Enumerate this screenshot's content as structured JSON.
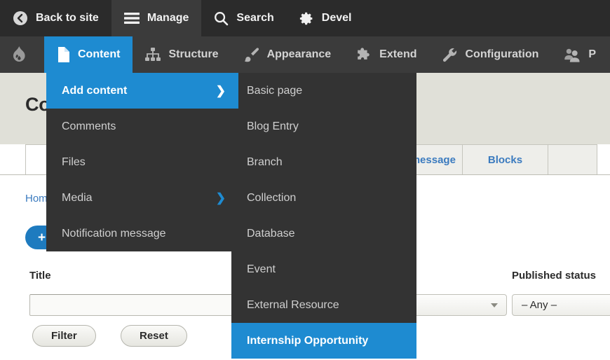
{
  "toolbar": {
    "top": [
      {
        "label": "Back to site",
        "icon": "back-arrow-icon",
        "active": false
      },
      {
        "label": "Manage",
        "icon": "hamburger-icon",
        "active": true
      },
      {
        "label": "Search",
        "icon": "search-icon",
        "active": false
      },
      {
        "label": "Devel",
        "icon": "gear-icon",
        "active": false
      }
    ],
    "second": [
      {
        "label": "",
        "icon": "drupal-logo-icon",
        "active": false
      },
      {
        "label": "Content",
        "icon": "document-icon",
        "active": true
      },
      {
        "label": "Structure",
        "icon": "sitemap-icon",
        "active": false
      },
      {
        "label": "Appearance",
        "icon": "paintbrush-icon",
        "active": false
      },
      {
        "label": "Extend",
        "icon": "puzzle-icon",
        "active": false
      },
      {
        "label": "Configuration",
        "icon": "wrench-icon",
        "active": false
      },
      {
        "label": "P",
        "icon": "people-icon",
        "active": false
      }
    ]
  },
  "menu": {
    "level1": [
      {
        "label": "Add content",
        "selected": true,
        "has_submenu": true,
        "chevron": "❯"
      },
      {
        "label": "Comments",
        "selected": false,
        "has_submenu": false,
        "chevron": ""
      },
      {
        "label": "Files",
        "selected": false,
        "has_submenu": false,
        "chevron": ""
      },
      {
        "label": "Media",
        "selected": false,
        "has_submenu": true,
        "chevron": "❯"
      },
      {
        "label": "Notification message",
        "selected": false,
        "has_submenu": false,
        "chevron": ""
      }
    ],
    "level2": [
      {
        "label": "Basic page",
        "selected": false
      },
      {
        "label": "Blog Entry",
        "selected": false
      },
      {
        "label": "Branch",
        "selected": false
      },
      {
        "label": "Collection",
        "selected": false
      },
      {
        "label": "Database",
        "selected": false
      },
      {
        "label": "Event",
        "selected": false
      },
      {
        "label": "External Resource",
        "selected": false
      },
      {
        "label": "Internship Opportunity",
        "selected": true
      }
    ]
  },
  "page": {
    "title": "Content",
    "breadcrumb": "Home",
    "add_button": {
      "plus": "+",
      "label": ""
    },
    "tabs": [
      {
        "label": "",
        "active": true
      },
      {
        "label": "",
        "active": false
      },
      {
        "label": "",
        "active": false
      },
      {
        "label": "Notification message",
        "active": false
      },
      {
        "label": "Blocks",
        "active": false
      },
      {
        "label": "",
        "active": false
      }
    ],
    "filters": {
      "title_label": "Title",
      "title_value": "",
      "title_placeholder": "",
      "type_label": "",
      "type_value": "",
      "published_label": "Published status",
      "published_value": "– Any –"
    },
    "buttons": {
      "filter": "Filter",
      "reset": "Reset"
    }
  },
  "colors": {
    "accent": "#1e8bd1",
    "toolbar_top": "#2b2b2b",
    "toolbar_second": "#3b3b3b",
    "menu_bg": "#333333",
    "page_head": "#e0e0d8",
    "link": "#3b7bbf"
  }
}
